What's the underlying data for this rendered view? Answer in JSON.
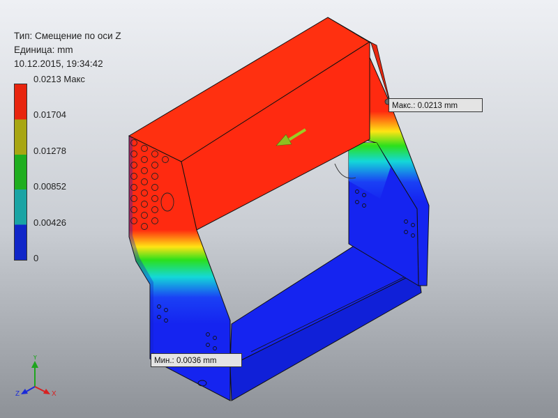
{
  "header": {
    "type_line": "Тип: Смещение по оси Z",
    "unit_line": "Единица: mm",
    "datetime": "10.12.2015, 19:34:42"
  },
  "legend": {
    "ticks": [
      "0.0213 Макс",
      "0.01704",
      "0.01278",
      "0.00852",
      "0.00426",
      "0"
    ],
    "colors": [
      "#e8250e",
      "#a8a612",
      "#1fae1f",
      "#1aa4a4",
      "#1026c8"
    ]
  },
  "callouts": {
    "max_label": "Макс.: 0.0213 mm",
    "min_label": "Мин.: 0.0036 mm"
  },
  "triad": {
    "x_label": "X",
    "y_label": "Y",
    "z_label": "Z"
  },
  "colors": {
    "high": "#ff2a10",
    "low": "#1524f0",
    "marker": "#9acd24"
  }
}
